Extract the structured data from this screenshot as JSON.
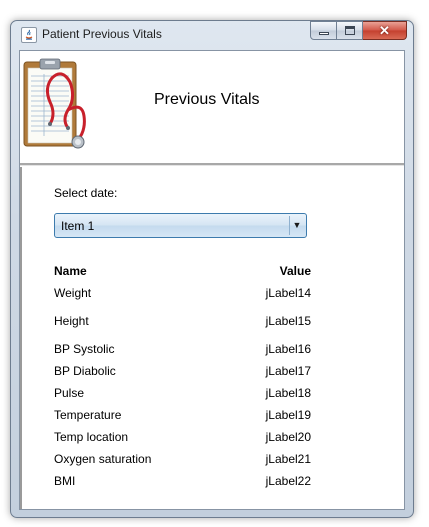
{
  "window": {
    "title": "Patient Previous Vitals",
    "controls": {
      "minimize": "minimize",
      "maximize": "maximize",
      "close": "✕"
    }
  },
  "header": {
    "title": "Previous Vitals",
    "logo_icon": "clipboard-stethoscope-icon"
  },
  "form": {
    "select_label": "Select date:",
    "date_combo": {
      "selected": "Item 1",
      "arrow": "▼"
    }
  },
  "vitals_table": {
    "columns": {
      "name": "Name",
      "value": "Value"
    },
    "rows": [
      {
        "name": "Weight",
        "value": "jLabel14"
      },
      {
        "name": "Height",
        "value": "jLabel15"
      },
      {
        "name": "BP Systolic",
        "value": "jLabel16"
      },
      {
        "name": "BP Diabolic",
        "value": "jLabel17"
      },
      {
        "name": "Pulse",
        "value": "jLabel18"
      },
      {
        "name": "Temperature",
        "value": "jLabel19"
      },
      {
        "name": "Temp location",
        "value": "jLabel20"
      },
      {
        "name": "Oxygen saturation",
        "value": "jLabel21"
      },
      {
        "name": "BMI",
        "value": "jLabel22"
      }
    ]
  },
  "colors": {
    "close_button": "#c4402f",
    "combo_border": "#3d7bad",
    "stethoscope": "#c8202b"
  }
}
